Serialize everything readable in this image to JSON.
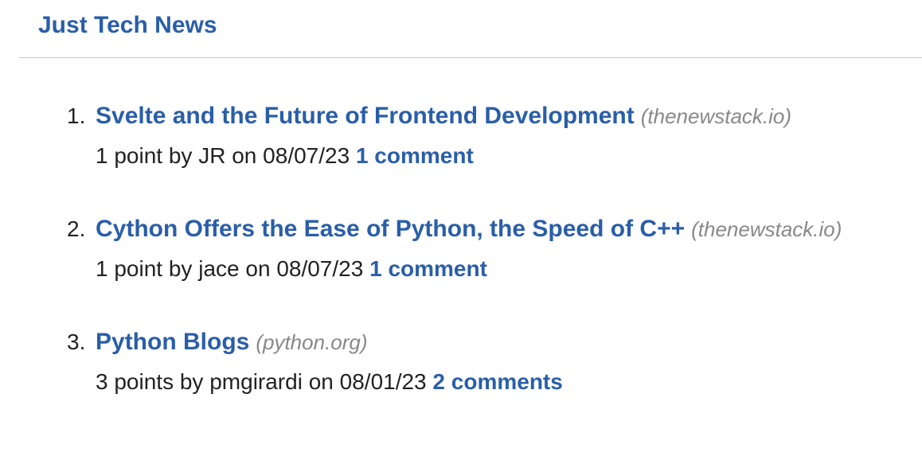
{
  "site": {
    "title": "Just Tech News"
  },
  "colors": {
    "link": "#2a5ea8",
    "text": "#222222",
    "domain": "#888888",
    "rule": "#c8c8c8"
  },
  "stories": [
    {
      "rank": "1.",
      "title": "Svelte and the Future of Frontend Development",
      "domain": "(thenewstack.io)",
      "points": "1 point",
      "by": "by",
      "author": "JR",
      "on": "on",
      "date": "08/07/23",
      "comments": "1 comment"
    },
    {
      "rank": "2.",
      "title": "Cython Offers the Ease of Python, the Speed of C++",
      "domain": "(thenewstack.io)",
      "points": "1 point",
      "by": "by",
      "author": "jace",
      "on": "on",
      "date": "08/07/23",
      "comments": "1 comment"
    },
    {
      "rank": "3.",
      "title": "Python Blogs",
      "domain": "(python.org)",
      "points": "3 points",
      "by": "by",
      "author": "pmgirardi",
      "on": "on",
      "date": "08/01/23",
      "comments": "2 comments"
    }
  ]
}
